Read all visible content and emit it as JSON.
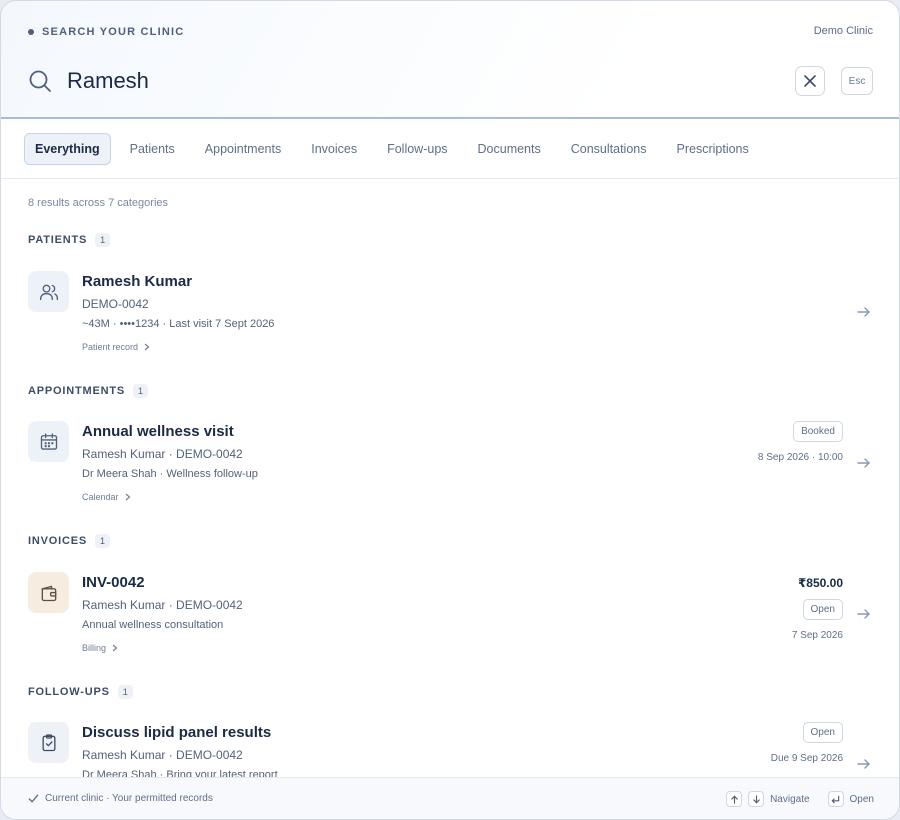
{
  "header": {
    "eyebrow": "SEARCH YOUR CLINIC",
    "clinic_name": "Demo Clinic",
    "search_value": "Ramesh",
    "esc_label": "Esc"
  },
  "tabs": [
    {
      "label": "Everything",
      "active": true
    },
    {
      "label": "Patients"
    },
    {
      "label": "Appointments"
    },
    {
      "label": "Invoices"
    },
    {
      "label": "Follow-ups"
    },
    {
      "label": "Documents"
    },
    {
      "label": "Consultations"
    },
    {
      "label": "Prescriptions"
    }
  ],
  "summary": "8 results across 7 categories",
  "sections": {
    "patients": {
      "title": "PATIENTS",
      "count": "1",
      "item": {
        "icon": "users-icon",
        "title": "Ramesh Kumar",
        "line1": "DEMO-0042",
        "line2": "~43M · ••••1234 · Last visit 7 Sept 2026",
        "link": "Patient record"
      }
    },
    "appointments": {
      "title": "APPOINTMENTS",
      "count": "1",
      "item": {
        "icon": "calendar-icon",
        "title": "Annual wellness visit",
        "line1": "Ramesh Kumar · DEMO-0042",
        "line2": "Dr Meera Shah · Wellness follow-up",
        "link": "Calendar",
        "status": "Booked",
        "date": "8 Sep 2026 · 10:00"
      }
    },
    "invoices": {
      "title": "INVOICES",
      "count": "1",
      "item": {
        "icon": "wallet-icon",
        "title": "INV-0042",
        "line1": "Ramesh Kumar · DEMO-0042",
        "line2": "Annual wellness consultation",
        "link": "Billing",
        "amount": "₹850.00",
        "status": "Open",
        "date": "7 Sep 2026"
      }
    },
    "followups": {
      "title": "FOLLOW-UPS",
      "count": "1",
      "item": {
        "icon": "clipboard-check-icon",
        "title": "Discuss lipid panel results",
        "line1": "Ramesh Kumar · DEMO-0042",
        "line2": "Dr Meera Shah · Bring your latest report",
        "status": "Open",
        "date": "Due 9 Sep 2026"
      }
    }
  },
  "footer": {
    "scope": "Current clinic · Your permitted records",
    "navigate": "Navigate",
    "open": "Open"
  },
  "colors": {
    "text": "#1b2b45",
    "muted": "#5f6f89",
    "accent_border": "#a9bcd3",
    "icon_tile": "#edf2f9",
    "invoice_tile": "#f7ece0"
  }
}
